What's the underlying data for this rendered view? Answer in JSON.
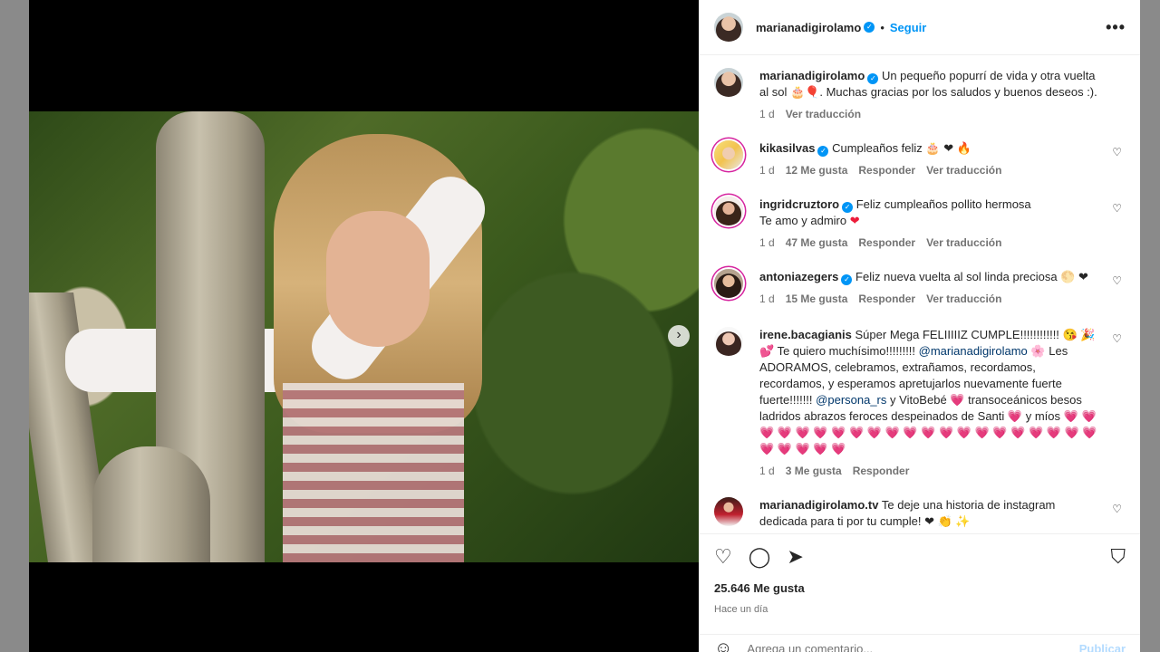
{
  "header": {
    "username": "marianadigirolamo",
    "separator": "•",
    "follow": "Seguir",
    "more": "•••"
  },
  "caption": {
    "username": "marianadigirolamo",
    "text_a": "Un pequeño popurrí de vida y otra vuelta al sol",
    "emoji_a": "🎂",
    "emoji_b": "🎈",
    "text_b": ". Muchas gracias por los saludos y buenos deseos :).",
    "age": "1 d",
    "translate": "Ver traducción"
  },
  "comments": [
    {
      "username": "kikasilvas",
      "text": "Cumpleaños feliz",
      "emojis": "🎂 ❤ 🔥",
      "age": "1 d",
      "likes": "12 Me gusta",
      "reply": "Responder",
      "translate": "Ver traducción"
    },
    {
      "username": "ingridcruztoro",
      "text": "Feliz cumpleaños pollito hermosa",
      "text2": "Te amo y admiro",
      "emojis": "❤",
      "age": "1 d",
      "likes": "47 Me gusta",
      "reply": "Responder",
      "translate": "Ver traducción"
    },
    {
      "username": "antoniazegers",
      "text": "Feliz nueva vuelta al sol linda preciosa",
      "emojis": "🌕 ❤",
      "age": "1 d",
      "likes": "15 Me gusta",
      "reply": "Responder",
      "translate": "Ver traducción"
    },
    {
      "username": "irene.bacagianis",
      "text_a": "Súper Mega FELIIIIIZ CUMPLE!!!!!!!!!!!!",
      "emojis_a": "😘 🎉 💕",
      "text_b": "Te quiero muchísimo!!!!!!!!!",
      "mention1": "@marianadigirolamo",
      "emoji_c": "🌸",
      "text_c": "Les ADORAMOS, celebramos, extrañamos, recordamos, recordamos, y esperamos apretujarlos nuevamente fuerte fuerte!!!!!!!",
      "mention2": "@persona_rs",
      "text_d": "y VitoBebé",
      "emoji_d": "💗",
      "text_e": "transoceánicos besos ladridos abrazos feroces despeinados de Santi",
      "emoji_e": "💗",
      "text_f": "y míos",
      "hearts": "💗 💗 💗 💗 💗 💗 💗 💗 💗 💗 💗 💗 💗 💗 💗 💗 💗 💗 💗 💗 💗 💗 💗 💗 💗 💗",
      "age": "1 d",
      "likes": "3 Me gusta",
      "reply": "Responder"
    },
    {
      "username": "marianadigirolamo.tv",
      "text": "Te deje una historia de instagram dedicada para ti por tu cumple!",
      "emojis": "❤ 👏 ✨"
    }
  ],
  "actions": {
    "like_icon": "♡",
    "comment_icon": "◯",
    "share_icon": "➤",
    "save_icon": "⛉"
  },
  "likes": "25.646 Me gusta",
  "time": "Hace un día",
  "add_comment": {
    "placeholder": "Agrega un comentario...",
    "publish": "Publicar",
    "smile_icon": "☺"
  },
  "carousel": {
    "next_icon": "›",
    "slides_count_shown": 10,
    "active_index": 0
  }
}
